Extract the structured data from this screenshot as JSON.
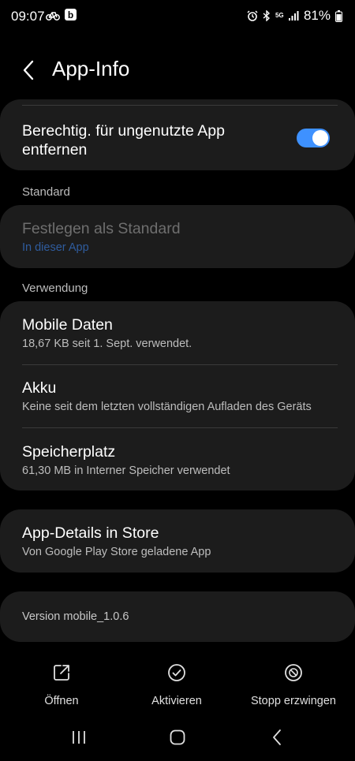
{
  "status_bar": {
    "time": "09:07",
    "battery": "81%",
    "left_icons": [
      "bike-icon",
      "b-app-icon"
    ],
    "right_icons": [
      "alarm-icon",
      "bluetooth-icon",
      "5g-icon",
      "signal-icon",
      "battery-icon"
    ],
    "b_app_letter": "b",
    "network_label": "5G"
  },
  "header": {
    "title": "App-Info"
  },
  "permissions_card": {
    "title": "Berechtig. für ungenutzte App entfernen",
    "toggle_on": true,
    "accent_color": "#3e91ff"
  },
  "standard_section": {
    "label": "Standard",
    "item_title": "Festlegen als Standard",
    "item_sub": "In dieser App"
  },
  "usage_section": {
    "label": "Verwendung",
    "items": [
      {
        "title": "Mobile Daten",
        "sub": "18,67 KB seit 1. Sept. verwendet."
      },
      {
        "title": "Akku",
        "sub": "Keine seit dem letzten vollständigen Aufladen des Geräts"
      },
      {
        "title": "Speicherplatz",
        "sub": "61,30 MB in Interner Speicher verwendet"
      }
    ]
  },
  "store_card": {
    "title": "App-Details in Store",
    "sub": "Von Google Play Store geladene App"
  },
  "version_card": {
    "text": "Version mobile_1.0.6"
  },
  "bottom_actions": [
    {
      "label": "Öffnen",
      "icon": "open-external-icon"
    },
    {
      "label": "Aktivieren",
      "icon": "check-circle-icon"
    },
    {
      "label": "Stopp erzwingen",
      "icon": "force-stop-icon"
    }
  ],
  "nav_bar": {
    "buttons": [
      "recents-icon",
      "home-icon",
      "back-icon"
    ]
  }
}
